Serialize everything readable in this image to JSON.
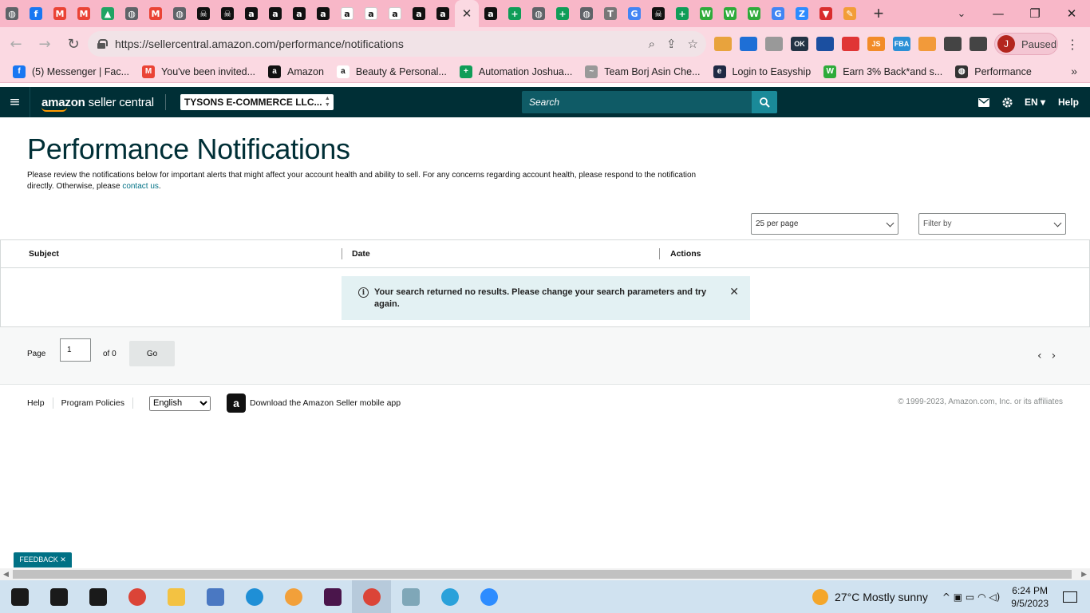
{
  "browser": {
    "tabs": [
      {
        "icon": "globe-icon",
        "color": "#5f6368",
        "glyph": "◍"
      },
      {
        "icon": "facebook-icon",
        "color": "#1877f2",
        "glyph": "f"
      },
      {
        "icon": "gmail-icon",
        "color": "#ea4335",
        "glyph": "M"
      },
      {
        "icon": "gmail-icon",
        "color": "#ea4335",
        "glyph": "M"
      },
      {
        "icon": "drive-icon",
        "color": "#1fa463",
        "glyph": "▲"
      },
      {
        "icon": "globe-icon",
        "color": "#5f6368",
        "glyph": "◍"
      },
      {
        "icon": "gmail-icon",
        "color": "#ea4335",
        "glyph": "M"
      },
      {
        "icon": "globe-icon",
        "color": "#5f6368",
        "glyph": "◍"
      },
      {
        "icon": "pirate-icon",
        "color": "#111111",
        "glyph": "☠"
      },
      {
        "icon": "pirate-icon",
        "color": "#111111",
        "glyph": "☠"
      },
      {
        "icon": "amazon-icon",
        "color": "#111111",
        "glyph": "a"
      },
      {
        "icon": "amazon-icon",
        "color": "#111111",
        "glyph": "a"
      },
      {
        "icon": "amazon-icon",
        "color": "#111111",
        "glyph": "a"
      },
      {
        "icon": "amazon-icon",
        "color": "#111111",
        "glyph": "a"
      },
      {
        "icon": "amazon-smile-icon",
        "color": "#ffffff",
        "glyph": "a"
      },
      {
        "icon": "amazon-smile-icon",
        "color": "#ffffff",
        "glyph": "a"
      },
      {
        "icon": "amazon-smile-icon",
        "color": "#ffffff",
        "glyph": "a"
      },
      {
        "icon": "amazon-icon",
        "color": "#111111",
        "glyph": "a"
      },
      {
        "icon": "amazon-icon",
        "color": "#111111",
        "glyph": "a"
      }
    ],
    "active_tab": {
      "icon": "close-icon",
      "glyph": "✕"
    },
    "tabs_after": [
      {
        "icon": "amazon-icon",
        "color": "#111111",
        "glyph": "a"
      },
      {
        "icon": "sheets-plus-icon",
        "color": "#0f9d58",
        "glyph": "+"
      },
      {
        "icon": "globe-icon",
        "color": "#5f6368",
        "glyph": "◍"
      },
      {
        "icon": "sheets-plus-icon",
        "color": "#0f9d58",
        "glyph": "+"
      },
      {
        "icon": "globe-icon",
        "color": "#5f6368",
        "glyph": "◍"
      },
      {
        "icon": "t-icon",
        "color": "#777777",
        "glyph": "T"
      },
      {
        "icon": "google-icon",
        "color": "#4285f4",
        "glyph": "G"
      },
      {
        "icon": "pirate-icon",
        "color": "#111111",
        "glyph": "☠"
      },
      {
        "icon": "sheets-plus-icon",
        "color": "#0f9d58",
        "glyph": "+"
      },
      {
        "icon": "w-icon",
        "color": "#2eab3a",
        "glyph": "W"
      },
      {
        "icon": "w-icon",
        "color": "#2eab3a",
        "glyph": "W"
      },
      {
        "icon": "w-icon",
        "color": "#2eab3a",
        "glyph": "W"
      },
      {
        "icon": "google-icon",
        "color": "#4285f4",
        "glyph": "G"
      },
      {
        "icon": "z-icon",
        "color": "#2d8cff",
        "glyph": "Z"
      },
      {
        "icon": "v-icon",
        "color": "#d92d2d",
        "glyph": "▼"
      },
      {
        "icon": "pencil-icon",
        "color": "#f29d38",
        "glyph": "✎"
      }
    ],
    "new_tab_glyph": "+",
    "tab_search_glyph": "⌄",
    "window_controls": [
      "—",
      "❐",
      "✕"
    ],
    "url": "https://sellercentral.amazon.com/performance/notifications",
    "omni_icons": [
      "⌕",
      "⇪",
      "☆"
    ],
    "nav_glyphs": {
      "back": "←",
      "forward": "→",
      "reload": "↻"
    },
    "extensions": [
      {
        "icon": "cake-icon",
        "color": "#e8a33d",
        "text": ""
      },
      {
        "icon": "blue-circle-icon",
        "color": "#1e6fd6",
        "text": ""
      },
      {
        "icon": "signature-icon",
        "color": "#999999",
        "text": ""
      },
      {
        "icon": "ok-icon",
        "color": "#223344",
        "text": "OK"
      },
      {
        "icon": "grid-icon",
        "color": "#1b4fa0",
        "text": ""
      },
      {
        "icon": "pokeball-icon",
        "color": "#e03535",
        "text": ""
      },
      {
        "icon": "js-icon",
        "color": "#f28c28",
        "text": "JS"
      },
      {
        "icon": "fba-icon",
        "color": "#2b8fd6",
        "text": "FBA"
      },
      {
        "icon": "orange-circle-icon",
        "color": "#f29a3a",
        "text": ""
      },
      {
        "icon": "puzzle-icon",
        "color": "#444444",
        "text": ""
      },
      {
        "icon": "sidepanel-icon",
        "color": "#444444",
        "text": ""
      }
    ],
    "profile": {
      "initial": "J",
      "label": "Paused"
    },
    "kebab_glyph": "⋮",
    "bookmarks": [
      {
        "label": "(5) Messenger | Fac...",
        "icon": "facebook-icon",
        "color": "#1877f2",
        "glyph": "f"
      },
      {
        "label": "You've been invited...",
        "icon": "gmail-icon",
        "color": "#ea4335",
        "glyph": "M"
      },
      {
        "label": "Amazon",
        "icon": "amazon-icon",
        "color": "#111111",
        "glyph": "a"
      },
      {
        "label": "Beauty & Personal...",
        "icon": "amazon-smile-icon",
        "color": "#ffffff",
        "glyph": "a"
      },
      {
        "label": "Automation Joshua...",
        "icon": "sheets-plus-icon",
        "color": "#0f9d58",
        "glyph": "+"
      },
      {
        "label": "Team Borj Asin Che...",
        "icon": "signature-icon",
        "color": "#999999",
        "glyph": "~"
      },
      {
        "label": "Login to Easyship",
        "icon": "easyship-icon",
        "color": "#1f2a44",
        "glyph": "e"
      },
      {
        "label": "Earn 3% Back*and s...",
        "icon": "w-icon",
        "color": "#2eab3a",
        "glyph": "W"
      },
      {
        "label": "Performance",
        "icon": "globe-icon",
        "color": "#333333",
        "glyph": "◍"
      }
    ],
    "bookmarks_more": "»"
  },
  "header": {
    "menu_glyph": "≡",
    "logo_bold": "amazon",
    "logo_rest": " seller central",
    "account": "TYSONS E-COMMERCE LLC...",
    "search_placeholder": "Search",
    "lang": "EN ▾",
    "help": "Help"
  },
  "page": {
    "title": "Performance Notifications",
    "intro": "Please review the notifications below for important alerts that might affect your account health and ability to sell. For any concerns regarding account health, please respond to the notification directly. Otherwise, please ",
    "contact_link": "contact us",
    "intro_end": ".",
    "per_page": "25 per page",
    "filter": "Filter by",
    "columns": [
      "Subject",
      "Date",
      "Actions"
    ],
    "alert": "Your search returned no results. Please change your search parameters and try again.",
    "alert_info_glyph": "i",
    "alert_close_glyph": "✕",
    "pager": {
      "label": "Page",
      "value": "1",
      "of": "of 0",
      "go": "Go",
      "prev": "‹",
      "next": "›"
    }
  },
  "footer": {
    "help": "Help",
    "policies": "Program Policies",
    "language": "English",
    "app_text": "Download the Amazon Seller mobile app",
    "copyright": "© 1999-2023, Amazon.com, Inc. or its affiliates"
  },
  "feedback": "FEEDBACK ✕",
  "taskbar": {
    "apps": [
      {
        "icon": "windows-start-icon",
        "color": "#1a1a1a"
      },
      {
        "icon": "search-icon",
        "color": "#1a1a1a"
      },
      {
        "icon": "task-view-icon",
        "color": "#1a1a1a"
      },
      {
        "icon": "chrome-icon",
        "color": "#db4437"
      },
      {
        "icon": "file-explorer-icon",
        "color": "#f3c242"
      },
      {
        "icon": "control-panel-icon",
        "color": "#4a78c2"
      },
      {
        "icon": "edge-icon",
        "color": "#1f8fd6"
      },
      {
        "icon": "brave-icon",
        "color": "#f2a03a"
      },
      {
        "icon": "slack-icon",
        "color": "#4a154b"
      },
      {
        "icon": "chrome-profile-icon",
        "color": "#db4437"
      },
      {
        "icon": "notes-icon",
        "color": "#7fa7b8"
      },
      {
        "icon": "telegram-icon",
        "color": "#2aa1da"
      },
      {
        "icon": "zoom-icon",
        "color": "#2d8cff"
      }
    ],
    "weather": "27°C  Mostly sunny",
    "sys_glyphs": "^  ▣  ▭  ◠  ◁)",
    "time": "6:24 PM",
    "date": "9/5/2023"
  }
}
